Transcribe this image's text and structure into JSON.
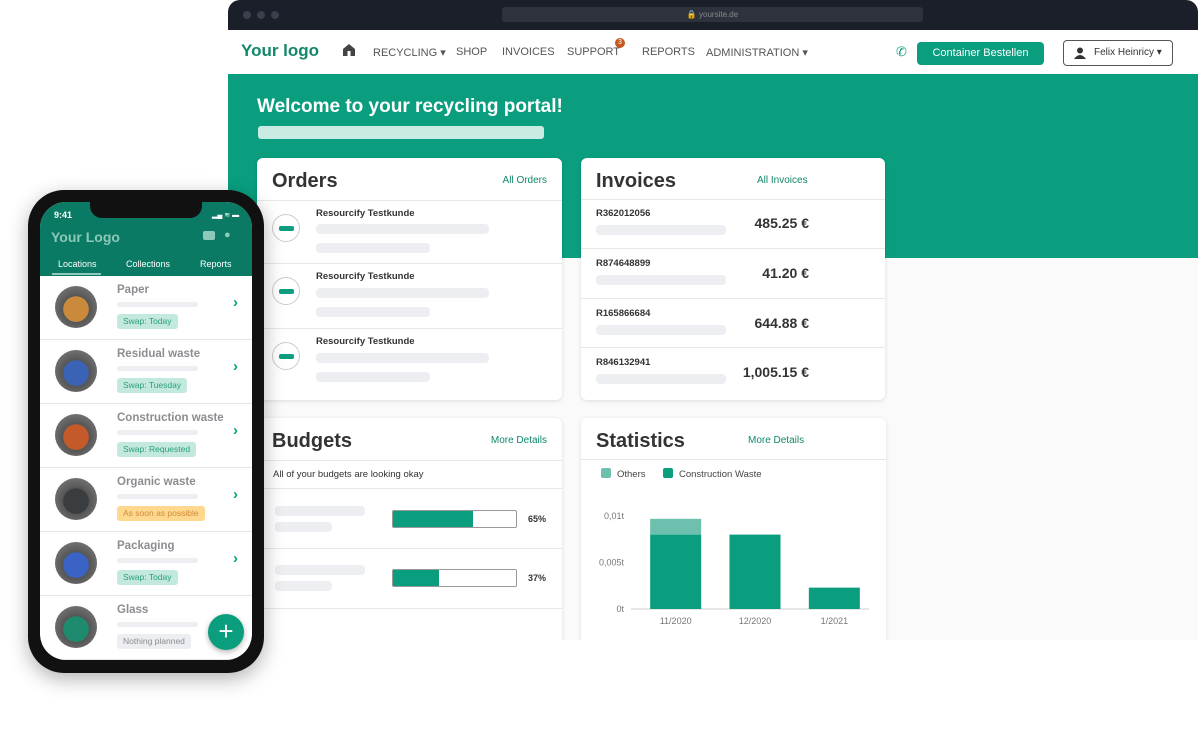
{
  "browser": {
    "url": "yoursite.de"
  },
  "nav": {
    "logo": "Your logo",
    "items": [
      "RECYCLING ▾",
      "SHOP",
      "INVOICES",
      "SUPPORT",
      "REPORTS",
      "ADMINISTRATION ▾"
    ],
    "support_badge": "3",
    "cta": "Container Bestellen",
    "user": "Felix Heinricy ▾"
  },
  "hero": {
    "title": "Welcome to your recycling portal!"
  },
  "orders": {
    "title": "Orders",
    "link": "All Orders",
    "rows": [
      {
        "name": "Resourcify Testkunde"
      },
      {
        "name": "Resourcify Testkunde"
      },
      {
        "name": "Resourcify Testkunde"
      }
    ]
  },
  "invoices": {
    "title": "Invoices",
    "link": "All Invoices",
    "rows": [
      {
        "number": "R362012056",
        "amount": "485.25 €"
      },
      {
        "number": "R874648899",
        "amount": "41.20 €"
      },
      {
        "number": "R165866684",
        "amount": "644.88 €"
      },
      {
        "number": "R846132941",
        "amount": "1,005.15 €"
      }
    ]
  },
  "budgets": {
    "title": "Budgets",
    "link": "More Details",
    "message": "All of your budgets are looking okay",
    "rows": [
      {
        "percent": 65,
        "label": "65%"
      },
      {
        "percent": 37,
        "label": "37%"
      }
    ]
  },
  "statistics": {
    "title": "Statistics",
    "link": "More Details"
  },
  "chart_data": {
    "type": "bar",
    "stacked": true,
    "categories": [
      "11/2020",
      "12/2020",
      "1/2021"
    ],
    "series": [
      {
        "name": "Others",
        "values": [
          0.0017,
          0,
          0
        ],
        "color": "#6cc0ad"
      },
      {
        "name": "Construction Waste",
        "values": [
          0.008,
          0.008,
          0.0023
        ],
        "color": "#0a9e7f"
      }
    ],
    "ylim": [
      0,
      0.01
    ],
    "yticks": [
      {
        "value": 0,
        "label": "0t"
      },
      {
        "value": 0.005,
        "label": "0,005t"
      },
      {
        "value": 0.01,
        "label": "0,01t"
      }
    ],
    "legend": "top-left",
    "grid": false
  },
  "phone": {
    "time": "9:41",
    "logo": "Your Logo",
    "tabs": [
      "Locations",
      "Collections",
      "Reports"
    ],
    "active_tab": "Locations",
    "items": [
      {
        "name": "Paper",
        "tag": "Swap: Today",
        "tag_type": "green",
        "thumb": "#c98a3c"
      },
      {
        "name": "Residual waste",
        "tag": "Swap: Tuesday",
        "tag_type": "green",
        "thumb": "#3b63b5"
      },
      {
        "name": "Construction waste",
        "tag": "Swap: Requested",
        "tag_type": "green",
        "thumb": "#c45a2a"
      },
      {
        "name": "Organic waste",
        "tag": "As soon as possible",
        "tag_type": "orange",
        "thumb": "#3a3d40"
      },
      {
        "name": "Packaging",
        "tag": "Swap: Today",
        "tag_type": "green",
        "thumb": "#3b63c5"
      },
      {
        "name": "Glass",
        "tag": "Nothing planned",
        "tag_type": "grey",
        "thumb": "#1e8a6e"
      }
    ],
    "fab": "+"
  },
  "colors": {
    "accent": "#0a9e7f",
    "dark_green": "#0b7a64",
    "tag_green": "#c3e9de",
    "tag_orange": "#fdd88e",
    "tag_grey": "#eceef2"
  }
}
